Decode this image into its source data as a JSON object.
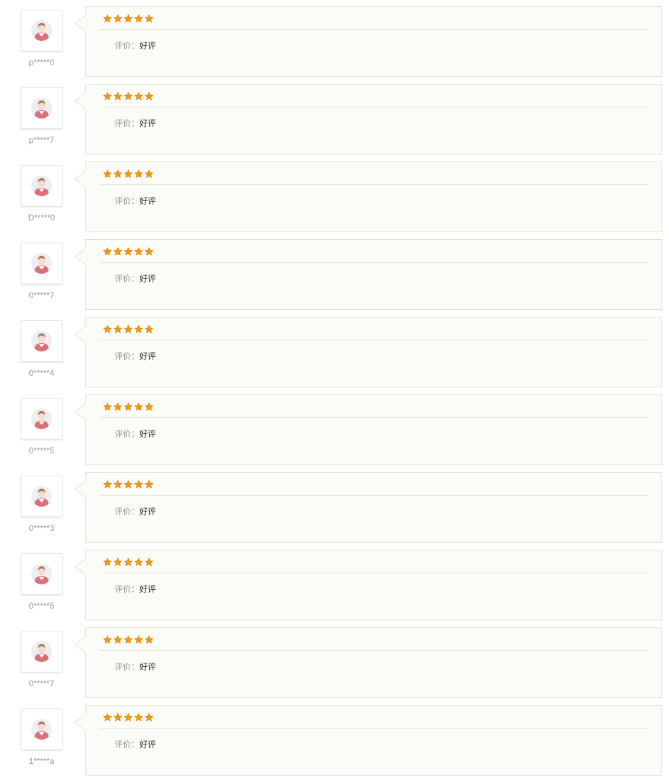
{
  "colors": {
    "star": "#f29a11",
    "bubble_bg": "#fbfcf8",
    "bubble_border": "#dde5cf",
    "username": "#999999",
    "label": "#999999"
  },
  "icons": {
    "avatar": "user-avatar-icon",
    "star": "star-icon"
  },
  "reviews": [
    {
      "username": "p*****0",
      "rating": 5,
      "label": "评价：",
      "comment": "好评"
    },
    {
      "username": "p*****7",
      "rating": 5,
      "label": "评价：",
      "comment": "好评"
    },
    {
      "username": "D*****0",
      "rating": 5,
      "label": "评价：",
      "comment": "好评"
    },
    {
      "username": "0*****7",
      "rating": 5,
      "label": "评价：",
      "comment": "好评"
    },
    {
      "username": "0*****4",
      "rating": 5,
      "label": "评价：",
      "comment": "好评"
    },
    {
      "username": "0*****5",
      "rating": 5,
      "label": "评价：",
      "comment": "好评"
    },
    {
      "username": "0*****3",
      "rating": 5,
      "label": "评价：",
      "comment": "好评"
    },
    {
      "username": "0*****5",
      "rating": 5,
      "label": "评价：",
      "comment": "好评"
    },
    {
      "username": "0*****7",
      "rating": 5,
      "label": "评价：",
      "comment": "好评"
    },
    {
      "username": "1*****a",
      "rating": 5,
      "label": "评价：",
      "comment": "好评"
    }
  ]
}
